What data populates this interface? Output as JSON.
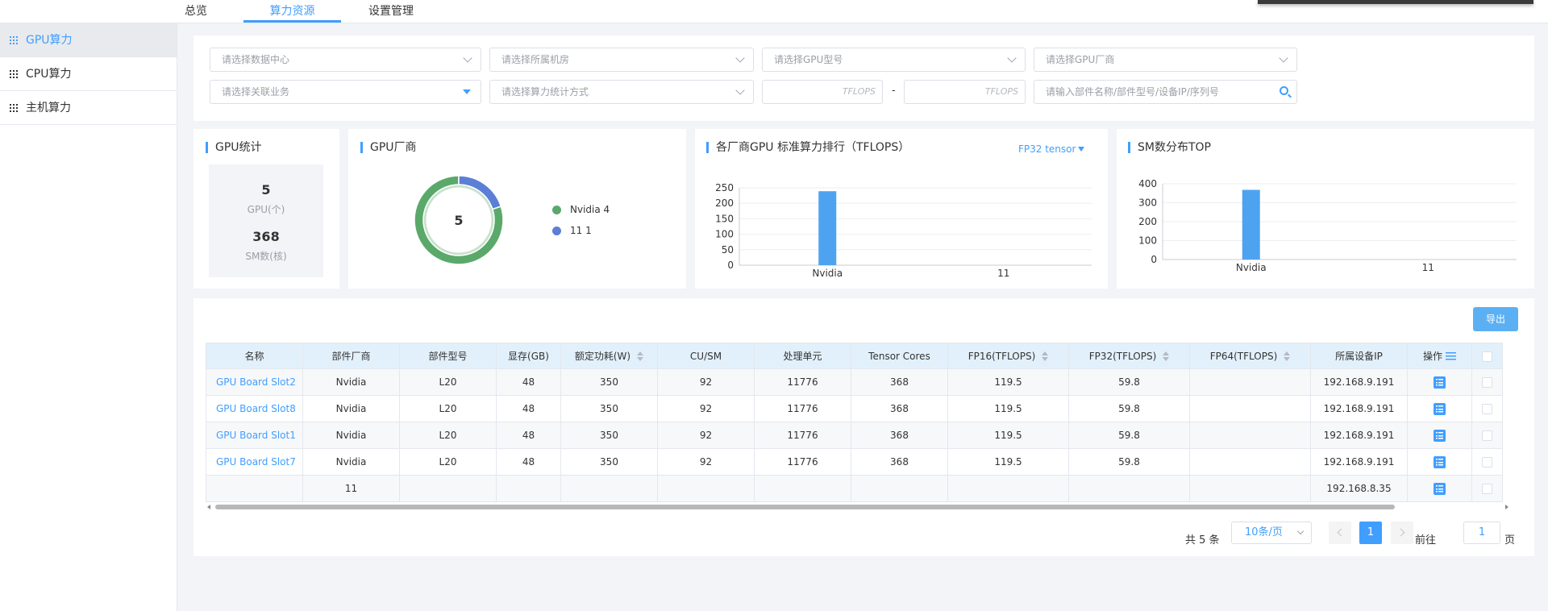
{
  "topnav": {
    "tabs": [
      {
        "label": "总览"
      },
      {
        "label": "算力资源"
      },
      {
        "label": "设置管理"
      }
    ]
  },
  "sidebar": {
    "items": [
      {
        "label": "GPU算力"
      },
      {
        "label": "CPU算力"
      },
      {
        "label": "主机算力"
      }
    ]
  },
  "filters": {
    "datacenter_placeholder": "请选择数据中心",
    "room_placeholder": "请选择所属机房",
    "gpu_model_placeholder": "请选择GPU型号",
    "gpu_vendor_placeholder": "请选择GPU厂商",
    "business_placeholder": "请选择关联业务",
    "stat_method_placeholder": "请选择算力统计方式",
    "tflops_min_placeholder": "TFLOPS",
    "range_dash": "-",
    "tflops_max_placeholder": "TFLOPS",
    "search_placeholder": "请输入部件名称/部件型号/设备IP/序列号"
  },
  "gpu_stats": {
    "title": "GPU统计",
    "gpu_count": "5",
    "gpu_count_label": "GPU(个)",
    "sm_count": "368",
    "sm_count_label": "SM数(核)"
  },
  "vendor_card": {
    "title": "GPU厂商",
    "center_value": "5",
    "legend": [
      {
        "name": "Nvidia",
        "value": "4",
        "text": "Nvidia 4",
        "color": "#5aa96a"
      },
      {
        "name": "11",
        "value": "1",
        "text": "11 1",
        "color": "#5b7fd6"
      }
    ]
  },
  "ranking_card": {
    "title": "各厂商GPU 标准算力排行（TFLOPS）",
    "dropdown_label": "FP32 tensor"
  },
  "sm_card": {
    "title": "SM数分布TOP"
  },
  "chart_data": [
    {
      "type": "pie",
      "title": "GPU厂商",
      "categories": [
        "Nvidia",
        "11"
      ],
      "values": [
        4,
        1
      ],
      "colors": [
        "#5aa96a",
        "#5b7fd6"
      ]
    },
    {
      "type": "bar",
      "title": "各厂商GPU 标准算力排行（TFLOPS）",
      "categories": [
        "Nvidia",
        "11"
      ],
      "values": [
        239,
        0
      ],
      "ylim": [
        0,
        250
      ],
      "yticks": [
        "0",
        "50",
        "100",
        "150",
        "200",
        "250"
      ],
      "grid": true,
      "color": "#4ea3f1"
    },
    {
      "type": "bar",
      "title": "SM数分布TOP",
      "categories": [
        "Nvidia",
        "11"
      ],
      "values": [
        368,
        0
      ],
      "ylim": [
        0,
        400
      ],
      "yticks": [
        "0",
        "100",
        "200",
        "300",
        "400"
      ],
      "grid": true,
      "color": "#4ea3f1"
    }
  ],
  "table": {
    "export_label": "导出",
    "columns": [
      "名称",
      "部件厂商",
      "部件型号",
      "显存(GB)",
      "额定功耗(W)",
      "CU/SM",
      "处理单元",
      "Tensor Cores",
      "FP16(TFLOPS)",
      "FP32(TFLOPS)",
      "FP64(TFLOPS)",
      "所属设备IP",
      "操作"
    ],
    "rows": [
      [
        "GPU Board Slot2",
        "Nvidia",
        "L20",
        "48",
        "350",
        "92",
        "11776",
        "368",
        "119.5",
        "59.8",
        "",
        "192.168.9.191"
      ],
      [
        "GPU Board Slot8",
        "Nvidia",
        "L20",
        "48",
        "350",
        "92",
        "11776",
        "368",
        "119.5",
        "59.8",
        "",
        "192.168.9.191"
      ],
      [
        "GPU Board Slot1",
        "Nvidia",
        "L20",
        "48",
        "350",
        "92",
        "11776",
        "368",
        "119.5",
        "59.8",
        "",
        "192.168.9.191"
      ],
      [
        "GPU Board Slot7",
        "Nvidia",
        "L20",
        "48",
        "350",
        "92",
        "11776",
        "368",
        "119.5",
        "59.8",
        "",
        "192.168.9.191"
      ],
      [
        "",
        "11",
        "",
        "",
        "",
        "",
        "",
        "",
        "",
        "",
        "",
        "192.168.8.35"
      ]
    ]
  },
  "pagination": {
    "total_text": "共 5 条",
    "page_size": "10条/页",
    "current_page": "1",
    "goto_label": "前往",
    "goto_value": "1",
    "page_suffix": "页"
  },
  "colors": {
    "accent": "#409eff",
    "header_bg": "#e2f0fb",
    "donut_green": "#5aa96a",
    "donut_blue": "#5b7fd6",
    "bar_blue": "#4ea3f1"
  }
}
